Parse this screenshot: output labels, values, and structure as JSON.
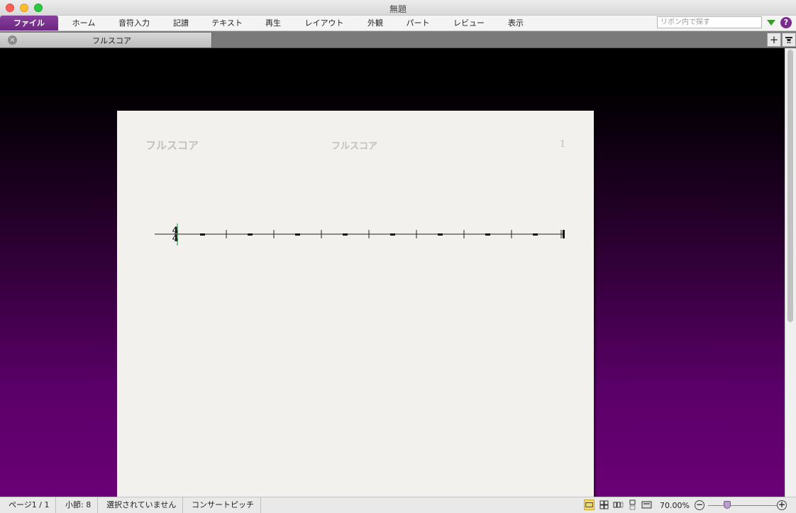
{
  "window": {
    "title": "無題"
  },
  "menu": {
    "items": [
      {
        "label": "ファイル"
      },
      {
        "label": "ホーム"
      },
      {
        "label": "音符入力"
      },
      {
        "label": "記譜"
      },
      {
        "label": "テキスト"
      },
      {
        "label": "再生"
      },
      {
        "label": "レイアウト"
      },
      {
        "label": "外観"
      },
      {
        "label": "パート"
      },
      {
        "label": "レビュー"
      },
      {
        "label": "表示"
      }
    ],
    "search_placeholder": "リボン内で探す",
    "help_glyph": "?"
  },
  "tabs": {
    "active_label": "フルスコア",
    "close_glyph": "×",
    "add_glyph": "+"
  },
  "score": {
    "header_left": "フルスコア",
    "header_center": "フルスコア",
    "page_number": "1",
    "time_signature": {
      "top": "4",
      "bottom": "4"
    },
    "measure_count": 8
  },
  "status": {
    "page": "ページ1 / 1",
    "bars": "小節: 8",
    "selection": "選択されていません",
    "pitch": "コンサートピッチ",
    "zoom": "70.00%"
  },
  "colors": {
    "accent": "#6b2780",
    "canvas_top": "#000000",
    "canvas_bottom": "#6b0076",
    "paper": "#f3f1ee"
  }
}
